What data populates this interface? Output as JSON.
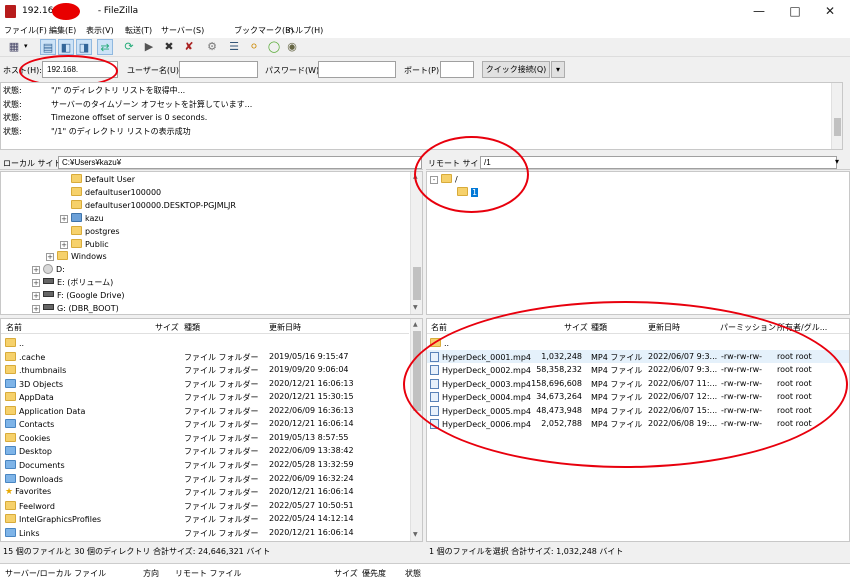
{
  "window": {
    "title_prefix": "192.168.1",
    "title_suffix": "- FileZilla",
    "controls": [
      "minimize-icon",
      "maximize-icon",
      "close-icon"
    ]
  },
  "menu": [
    "ファイル(F)",
    "編集(E)",
    "表示(V)",
    "転送(T)",
    "サーバー(S)",
    "ブックマーク(B)",
    "ヘルプ(H)"
  ],
  "toolbar": {
    "icons": [
      "site-manager-icon",
      "toggle-log-icon",
      "toggle-local-tree-icon",
      "toggle-remote-tree-icon",
      "toggle-queue-icon",
      "refresh-icon",
      "process-queue-icon",
      "cancel-icon",
      "disconnect-icon",
      "reconnect-icon",
      "filter-icon",
      "compare-icon",
      "sync-browse-icon",
      "search-icon"
    ]
  },
  "quickconnect": {
    "host_label": "ホスト(H):",
    "host_value": "192.168.",
    "user_label": "ユーザー名(U):",
    "user_value": "",
    "password_label": "パスワード(W):",
    "password_value": "",
    "port_label": "ポート(P):",
    "port_value": "",
    "button_label": "クイック接続(Q)"
  },
  "log": [
    {
      "tag": "状態:",
      "msg": "\"/\" のディレクトリ リストを取得中..."
    },
    {
      "tag": "状態:",
      "msg": "サーバーのタイムゾーン オフセットを計算しています..."
    },
    {
      "tag": "状態:",
      "msg": "Timezone offset of server is 0 seconds."
    },
    {
      "tag": "状態:",
      "msg": "\"/1\" のディレクトリ リストの表示成功"
    }
  ],
  "local": {
    "site_label": "ローカル サイト:",
    "site_path": "C:¥Users¥kazu¥",
    "tree": [
      {
        "label": "Default User",
        "indent": 4,
        "icon": "folder",
        "exp": ""
      },
      {
        "label": "defaultuser100000",
        "indent": 4,
        "icon": "folder",
        "exp": ""
      },
      {
        "label": "defaultuser100000.DESKTOP-PGJMLJR",
        "indent": 4,
        "icon": "folder",
        "exp": ""
      },
      {
        "label": "kazu",
        "indent": 4,
        "icon": "user",
        "exp": "+"
      },
      {
        "label": "postgres",
        "indent": 4,
        "icon": "folder",
        "exp": ""
      },
      {
        "label": "Public",
        "indent": 4,
        "icon": "folder",
        "exp": "+"
      },
      {
        "label": "Windows",
        "indent": 3,
        "icon": "folder",
        "exp": "+"
      },
      {
        "label": "D:",
        "indent": 2,
        "icon": "disc",
        "exp": "+"
      },
      {
        "label": "E: (ボリューム)",
        "indent": 2,
        "icon": "drive",
        "exp": "+"
      },
      {
        "label": "F: (Google Drive)",
        "indent": 2,
        "icon": "drive",
        "exp": "+"
      },
      {
        "label": "G: (DBR_BOOT)",
        "indent": 2,
        "icon": "drive",
        "exp": "+"
      }
    ],
    "columns": [
      "名前",
      "サイズ",
      "種類",
      "更新日時"
    ],
    "files": [
      {
        "name": "..",
        "size": "",
        "type": "",
        "date": "",
        "icon": "folder"
      },
      {
        "name": ".cache",
        "size": "",
        "type": "ファイル フォルダー",
        "date": "2019/05/16 9:15:47",
        "icon": "folder"
      },
      {
        "name": ".thumbnails",
        "size": "",
        "type": "ファイル フォルダー",
        "date": "2019/09/20 9:06:04",
        "icon": "folder"
      },
      {
        "name": "3D Objects",
        "size": "",
        "type": "ファイル フォルダー",
        "date": "2020/12/21 16:06:13",
        "icon": "folder-blue"
      },
      {
        "name": "AppData",
        "size": "",
        "type": "ファイル フォルダー",
        "date": "2020/12/21 15:30:15",
        "icon": "folder"
      },
      {
        "name": "Application Data",
        "size": "",
        "type": "ファイル フォルダー",
        "date": "2022/06/09 16:36:13",
        "icon": "folder"
      },
      {
        "name": "Contacts",
        "size": "",
        "type": "ファイル フォルダー",
        "date": "2020/12/21 16:06:14",
        "icon": "folder-blue"
      },
      {
        "name": "Cookies",
        "size": "",
        "type": "ファイル フォルダー",
        "date": "2019/05/13 8:57:55",
        "icon": "folder"
      },
      {
        "name": "Desktop",
        "size": "",
        "type": "ファイル フォルダー",
        "date": "2022/06/09 13:38:42",
        "icon": "folder-blue"
      },
      {
        "name": "Documents",
        "size": "",
        "type": "ファイル フォルダー",
        "date": "2022/05/28 13:32:59",
        "icon": "folder-blue"
      },
      {
        "name": "Downloads",
        "size": "",
        "type": "ファイル フォルダー",
        "date": "2022/06/09 16:32:24",
        "icon": "folder-blue"
      },
      {
        "name": "Favorites",
        "size": "",
        "type": "ファイル フォルダー",
        "date": "2020/12/21 16:06:14",
        "icon": "star"
      },
      {
        "name": "Feelword",
        "size": "",
        "type": "ファイル フォルダー",
        "date": "2022/05/27 10:50:51",
        "icon": "folder"
      },
      {
        "name": "IntelGraphicsProfiles",
        "size": "",
        "type": "ファイル フォルダー",
        "date": "2022/05/24 14:12:14",
        "icon": "folder"
      },
      {
        "name": "Links",
        "size": "",
        "type": "ファイル フォルダー",
        "date": "2020/12/21 16:06:14",
        "icon": "folder-blue"
      }
    ],
    "status": "15 個のファイルと 30 個のディレクトリ 合計サイズ: 24,646,321 バイト"
  },
  "remote": {
    "site_label": "リモート サイト:",
    "site_path": "/1",
    "tree": [
      {
        "label": "/",
        "indent": 0,
        "exp": "-"
      },
      {
        "label": "1",
        "indent": 1,
        "exp": "",
        "selected": true
      }
    ],
    "columns": [
      "名前",
      "サイズ",
      "種類",
      "更新日時",
      "パーミッション",
      "所有者/グル..."
    ],
    "files": [
      {
        "name": "..",
        "size": "",
        "type": "",
        "date": "",
        "perm": "",
        "owner": "",
        "icon": "folder"
      },
      {
        "name": "HyperDeck_0001.mp4",
        "size": "1,032,248",
        "type": "MP4 ファイル",
        "date": "2022/06/07 9:3...",
        "perm": "-rw-rw-rw-",
        "owner": "root root",
        "icon": "file",
        "selected": true
      },
      {
        "name": "HyperDeck_0002.mp4",
        "size": "58,358,232",
        "type": "MP4 ファイル",
        "date": "2022/06/07 9:3...",
        "perm": "-rw-rw-rw-",
        "owner": "root root",
        "icon": "file"
      },
      {
        "name": "HyperDeck_0003.mp4",
        "size": "158,696,608",
        "type": "MP4 ファイル",
        "date": "2022/06/07 11:...",
        "perm": "-rw-rw-rw-",
        "owner": "root root",
        "icon": "file"
      },
      {
        "name": "HyperDeck_0004.mp4",
        "size": "34,673,264",
        "type": "MP4 ファイル",
        "date": "2022/06/07 12:...",
        "perm": "-rw-rw-rw-",
        "owner": "root root",
        "icon": "file"
      },
      {
        "name": "HyperDeck_0005.mp4",
        "size": "48,473,948",
        "type": "MP4 ファイル",
        "date": "2022/06/07 15:...",
        "perm": "-rw-rw-rw-",
        "owner": "root root",
        "icon": "file"
      },
      {
        "name": "HyperDeck_0006.mp4",
        "size": "2,052,788",
        "type": "MP4 ファイル",
        "date": "2022/06/08 19:...",
        "perm": "-rw-rw-rw-",
        "owner": "root root",
        "icon": "file"
      }
    ],
    "status": "1 個のファイルを選択 合計サイズ: 1,032,248 バイト"
  },
  "queue": {
    "columns": [
      "サーバー/ローカル ファイル",
      "方向",
      "リモート ファイル",
      "サイズ",
      "優先度",
      "状態"
    ]
  },
  "colors": {
    "annotation_red": "#e8000d",
    "selection_blue": "#0078d7"
  }
}
